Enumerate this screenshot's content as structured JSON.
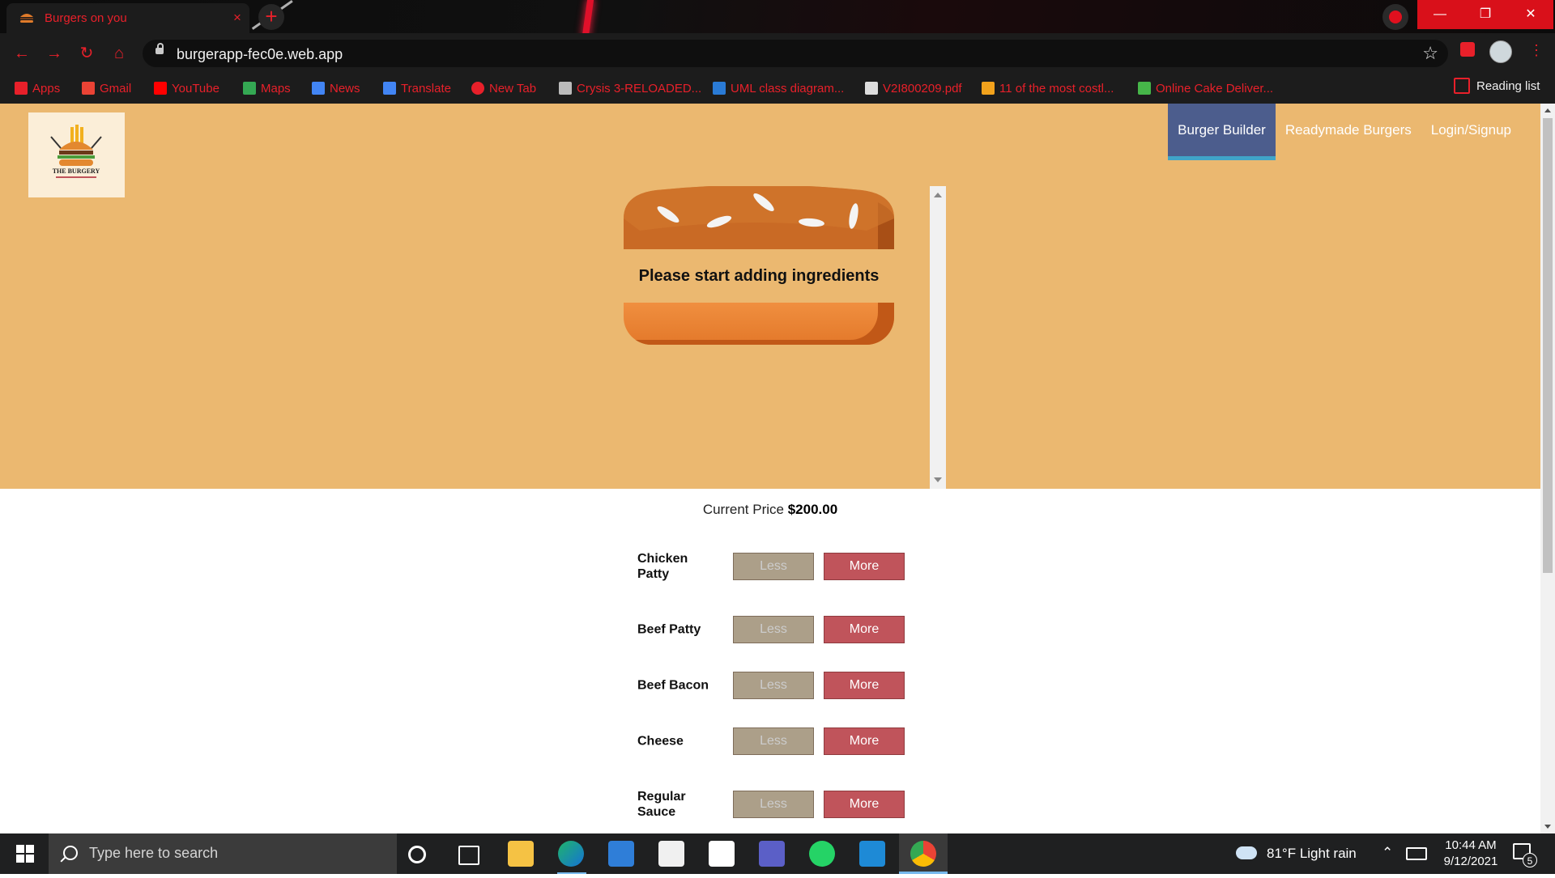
{
  "browser": {
    "tab_title": "Burgers on you",
    "tab_close": "×",
    "new_tab": "+",
    "url": "burgerapp-fec0e.web.app",
    "bookmarks": [
      {
        "label": "Apps",
        "icon": "apps-grid-icon",
        "color": "#e8202a"
      },
      {
        "label": "Gmail",
        "icon": "gmail-icon",
        "color": "#ea4335"
      },
      {
        "label": "YouTube",
        "icon": "youtube-icon",
        "color": "#ff0000"
      },
      {
        "label": "Maps",
        "icon": "maps-icon",
        "color": "#34a853"
      },
      {
        "label": "News",
        "icon": "news-icon",
        "color": "#4285f4"
      },
      {
        "label": "Translate",
        "icon": "translate-icon",
        "color": "#4285f4"
      },
      {
        "label": "New Tab",
        "icon": "new-tab-icon",
        "color": "#e8202a"
      },
      {
        "label": "Crysis 3-RELOADED...",
        "icon": "crysis-icon",
        "color": "#bbbbbb"
      },
      {
        "label": "UML class diagram...",
        "icon": "uml-icon",
        "color": "#2a7bd6"
      },
      {
        "label": "V2I800209.pdf",
        "icon": "pdf-icon",
        "color": "#dddddd"
      },
      {
        "label": "11 of the most costl...",
        "icon": "article-icon",
        "color": "#f2a21c"
      },
      {
        "label": "Online Cake Deliver...",
        "icon": "cake-icon",
        "color": "#46b649"
      }
    ],
    "reading_list": "Reading list"
  },
  "app": {
    "nav": [
      "Burger Builder",
      "Readymade Burgers",
      "Login/Signup"
    ],
    "logo_text": "THE BURGERY",
    "empty_message": "Please start adding ingredients",
    "price_label": "Current Price",
    "price_value": "$200.00",
    "controls": [
      {
        "label": "Chicken Patty",
        "less": "Less",
        "more": "More"
      },
      {
        "label": "Beef Patty",
        "less": "Less",
        "more": "More"
      },
      {
        "label": "Beef Bacon",
        "less": "Less",
        "more": "More"
      },
      {
        "label": "Cheese",
        "less": "Less",
        "more": "More"
      },
      {
        "label": "Regular Sauce",
        "less": "Less",
        "more": "More"
      }
    ]
  },
  "taskbar": {
    "search_placeholder": "Type here to search",
    "weather": "81°F  Light rain",
    "time": "10:44 AM",
    "date": "9/12/2021",
    "notifications": "5"
  },
  "colors": {
    "accent_red": "#e8202a",
    "header_bg": "#ebb870",
    "nav_active": "#4c5d8d",
    "less_button": "#ac9f89",
    "more_button": "#c0545b"
  }
}
